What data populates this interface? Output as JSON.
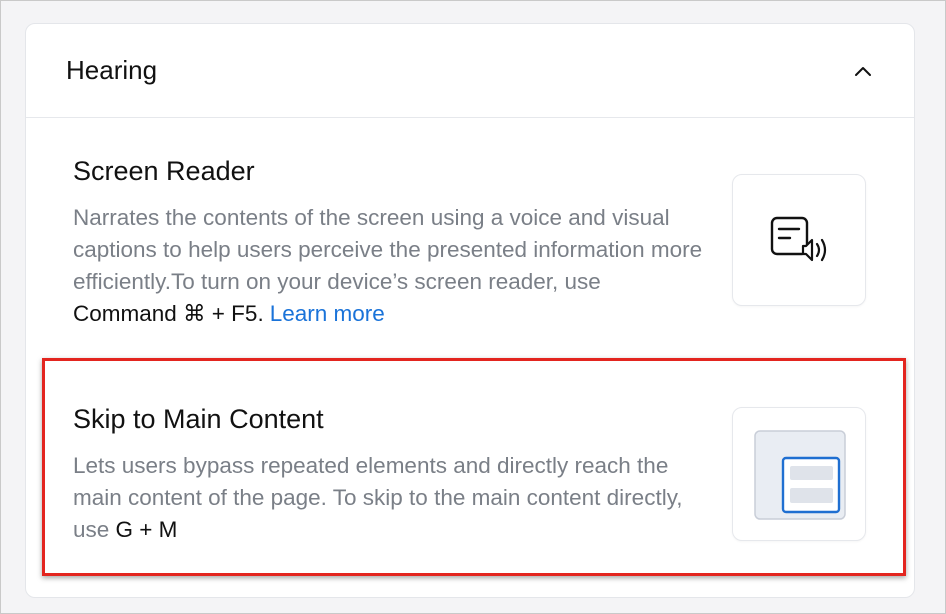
{
  "section": {
    "title": "Hearing",
    "collapse_icon": "chevron-up-icon"
  },
  "features": [
    {
      "title": "Screen Reader",
      "description": "Narrates the contents of the screen using a voice and visual captions to help users perceive the presented information more efficiently.To turn on your device’s screen reader, use ",
      "shortcut": "Command ⌘ + F5.",
      "link": "Learn more",
      "icon": "screen-reader-icon"
    },
    {
      "title": "Skip to Main Content",
      "description": "Lets users bypass repeated elements and directly reach the main content of the page. To skip to the main content directly, use ",
      "shortcut": "G + M",
      "icon": "skip-to-main-content-icon"
    }
  ],
  "colors": {
    "link": "#1a73d9",
    "highlight_border": "#e3251f",
    "description_text": "#7a7f87",
    "thumbnail_accent": "#1f6fd1"
  }
}
